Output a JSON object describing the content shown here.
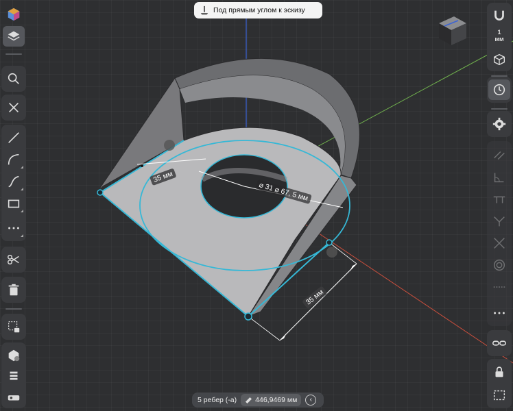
{
  "hint": {
    "label": "Под прямым углом к эскизу",
    "icon": "sketch-normal-icon"
  },
  "units": {
    "label": "1\nмм"
  },
  "dimensions": {
    "left_edge": "35 мм",
    "bottom_edge": "35 мм",
    "hole_diameter": "⌀ 31 ⌀ 67, 5 мм",
    "hole_unit": "мм"
  },
  "status": {
    "selection": "5 ребер (-а)",
    "length": "446,9469 мм"
  },
  "left_toolbar": {
    "items": [
      "appearance-icon",
      "layers-icon",
      "search-icon",
      "close-icon",
      "line-icon",
      "arc-icon",
      "spline-icon",
      "rectangle-icon",
      "more-icon",
      "scissors-icon",
      "trash-icon",
      "selection-lock-icon",
      "boolean-icon",
      "extrude-icon",
      "measure-icon"
    ]
  },
  "right_toolbar": {
    "items": [
      "magnet-icon",
      "view-cube-icon",
      "history-icon",
      "settings-icon",
      "parallel-icon",
      "angle-icon",
      "perpendicular-icon",
      "tangent-icon",
      "intersection-icon",
      "concentric-icon",
      "dashed-icon",
      "more-icon",
      "link-icon",
      "lock-icon",
      "frame-select-icon"
    ]
  },
  "colors": {
    "background": "#2e2f31",
    "selection": "#36b8d6",
    "axis_blue": "#3b63d6",
    "axis_green": "#6fae4d",
    "axis_red": "#c84e3c",
    "panel": "#3a3b3e"
  }
}
